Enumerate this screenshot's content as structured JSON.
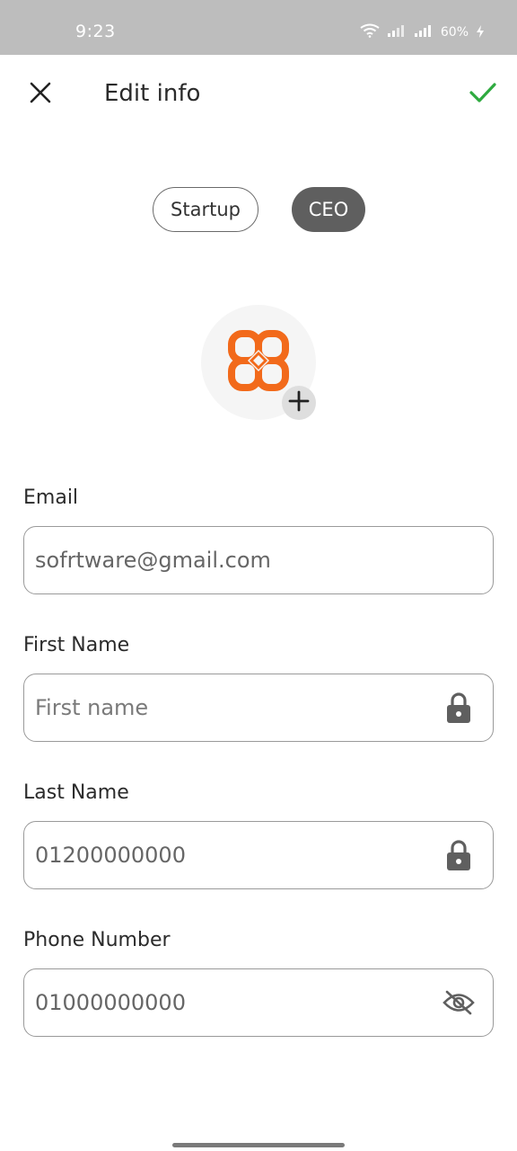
{
  "status_bar": {
    "time": "9:23",
    "battery": "60%"
  },
  "header": {
    "title": "Edit info",
    "close_icon": "close-icon",
    "confirm_icon": "check-icon",
    "confirm_color": "#2eaa3f"
  },
  "roles": {
    "startup_label": "Startup",
    "ceo_label": "CEO",
    "selected": "CEO"
  },
  "avatar": {
    "logo": "orange-flower-logo",
    "logo_color": "#f26a1b",
    "add_icon": "plus-icon"
  },
  "form": {
    "email": {
      "label": "Email",
      "value": "sofrtware@gmail.com"
    },
    "first_name": {
      "label": "First Name",
      "placeholder": "First name",
      "icon": "lock-icon"
    },
    "last_name": {
      "label": "Last Name",
      "value": "01200000000",
      "icon": "lock-icon"
    },
    "phone": {
      "label": "Phone Number",
      "value": "01000000000",
      "icon": "eye-off-icon"
    }
  }
}
